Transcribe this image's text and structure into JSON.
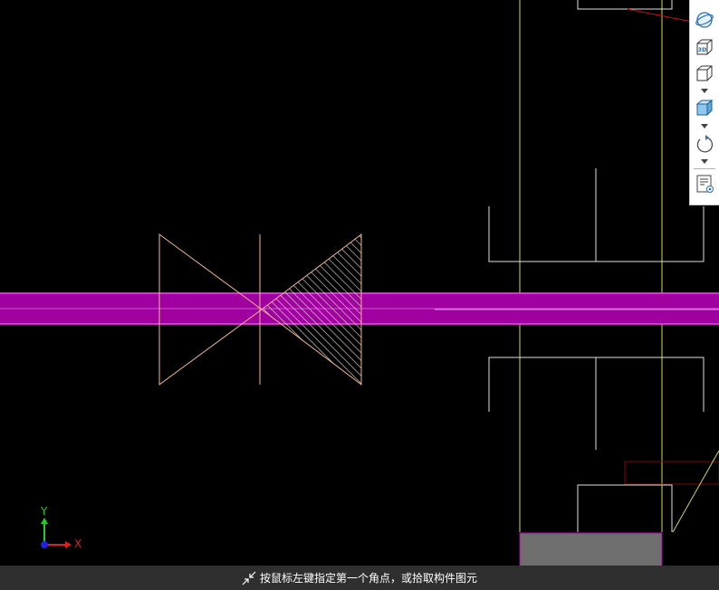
{
  "colors": {
    "background": "#000000",
    "pipe": "#b000b0",
    "pipe_edge": "#ff40ff",
    "valve": "#f0b890",
    "wall_white": "#e0e0e0",
    "grid_yellow": "#d8d84a",
    "red_line": "#cc1111",
    "dark_red_rect": "#8b0000",
    "gray_block": "#6e6e6e",
    "axis_x": "#e02020",
    "axis_y": "#20d020",
    "status_bg": "#2f2f2f"
  },
  "toolbar": {
    "items": [
      {
        "icon": "orbit-icon"
      },
      {
        "icon": "3d-view-icon",
        "label": "3D"
      },
      {
        "icon": "box-wireframe-icon"
      },
      {
        "icon": "box-shaded-icon"
      },
      {
        "icon": "rotate-icon"
      },
      {
        "icon": "properties-list-icon"
      }
    ]
  },
  "axis": {
    "x_label": "X",
    "y_label": "Y"
  },
  "status": {
    "message": "按鼠标左键指定第一个角点，或拾取构件图元",
    "icon": "shrink-arrows-icon"
  }
}
